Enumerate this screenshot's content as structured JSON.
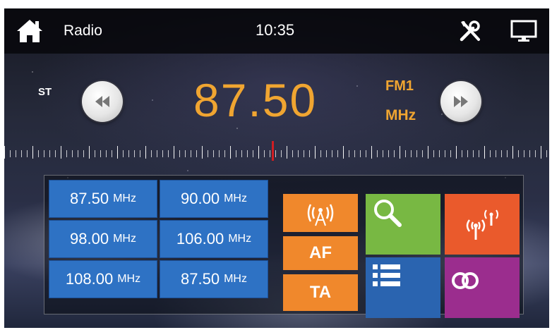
{
  "header": {
    "title": "Radio",
    "clock": "10:35"
  },
  "tuner": {
    "stereo": "ST",
    "frequency": "87.50",
    "band": "FM1",
    "unit": "MHz",
    "dial_position": 0.5
  },
  "presets": [
    {
      "value": "87.50",
      "unit": "MHz"
    },
    {
      "value": "90.00",
      "unit": "MHz"
    },
    {
      "value": "98.00",
      "unit": "MHz"
    },
    {
      "value": "106.00",
      "unit": "MHz"
    },
    {
      "value": "108.00",
      "unit": "MHz"
    },
    {
      "value": "87.50",
      "unit": "MHz"
    }
  ],
  "controls": {
    "af": "AF",
    "ta": "TA"
  },
  "icons": {
    "home": "home-icon",
    "tools": "tools-icon",
    "display": "display-icon",
    "seek_back": "rewind-icon",
    "seek_forward": "fast-forward-icon",
    "antenna": "antenna-icon",
    "search": "search-icon",
    "signal": "signal-tower-icon",
    "list": "list-icon",
    "stereo_mode": "stereo-rings-icon"
  },
  "colors": {
    "frequency": "#f0a531",
    "preset": "#2e72c4",
    "orange": "#f0882c",
    "green": "#78b843",
    "red": "#ea5a2c",
    "blue": "#2a64b0",
    "purple": "#9b2d8e",
    "needle": "#d01d22"
  }
}
